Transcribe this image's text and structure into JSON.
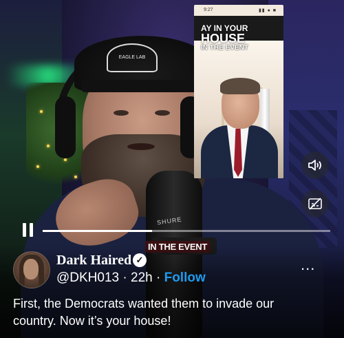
{
  "video": {
    "inset_time": "9:27",
    "inset_status_icons": "▮▮ ● ■",
    "headline_line1": "AY IN YOUR",
    "headline_line2": "HOUSE",
    "headline_line3": "IN THE EVENT",
    "cap_text": "EAGLE LAB",
    "mic_brand": "SHURE",
    "chyron": "IN THE EVENT",
    "progress": 0.38
  },
  "controls": {
    "pause_icon": "pause-icon",
    "volume_icon": "speaker-icon",
    "captions_icon": "captions-icon"
  },
  "tweet": {
    "display_name": "Dark Haired",
    "verified_badge": "✓",
    "handle": "@DKH013",
    "separator": " · ",
    "time": "22h",
    "follow_label": "Follow",
    "more_label": "...",
    "text": "First, the Democrats wanted them to invade our country. Now it’s your house!"
  },
  "colors": {
    "follow_blue": "#1d9bf0",
    "tie_red": "#9b1d2c"
  }
}
